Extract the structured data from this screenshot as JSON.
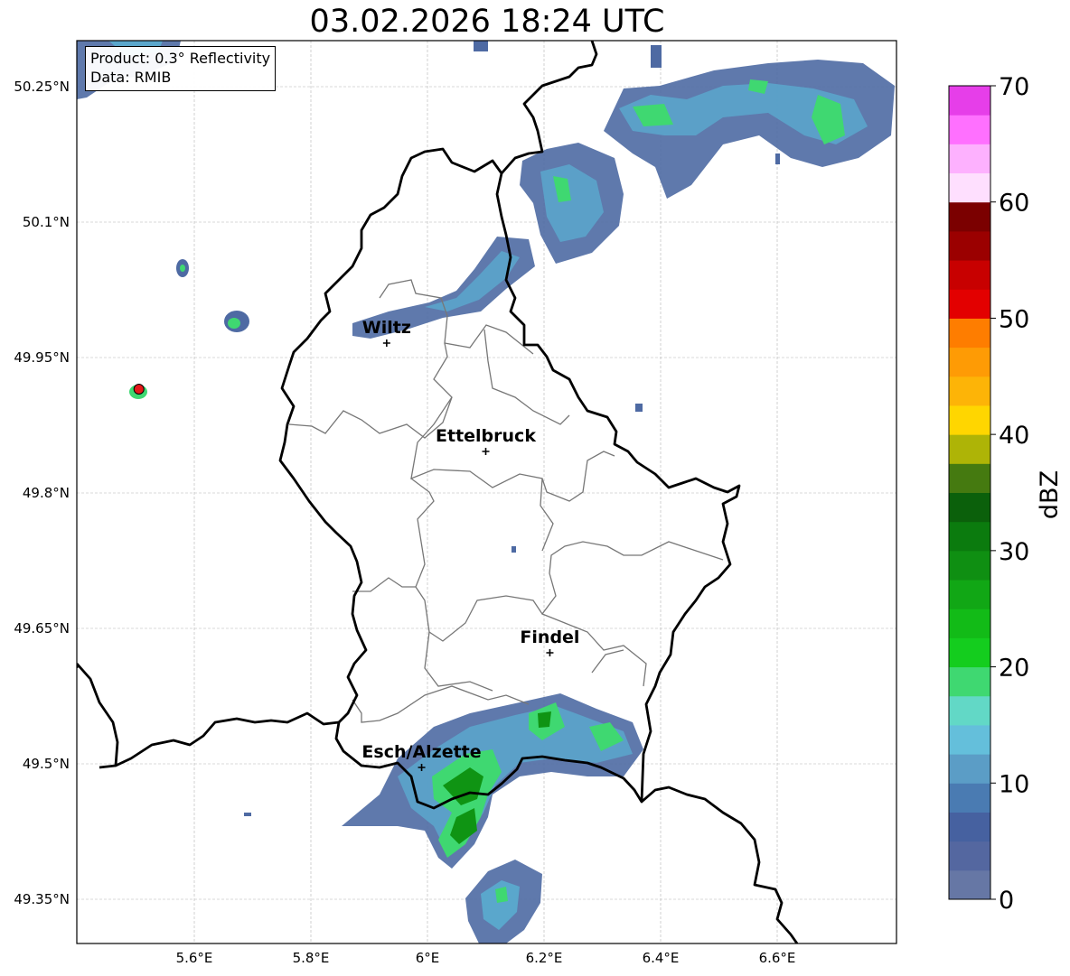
{
  "title": "03.02.2026 18:24 UTC",
  "info": {
    "product": "Product: 0.3° Reflectivity",
    "data": "Data: RMIB"
  },
  "lat_ticks": [
    {
      "value": 50.25,
      "label": "50.25°N"
    },
    {
      "value": 50.1,
      "label": "50.1°N"
    },
    {
      "value": 49.95,
      "label": "49.95°N"
    },
    {
      "value": 49.8,
      "label": "49.8°N"
    },
    {
      "value": 49.65,
      "label": "49.65°N"
    },
    {
      "value": 49.5,
      "label": "49.5°N"
    },
    {
      "value": 49.35,
      "label": "49.35°N"
    }
  ],
  "lon_ticks": [
    {
      "value": 5.6,
      "label": "5.6°E"
    },
    {
      "value": 5.8,
      "label": "5.8°E"
    },
    {
      "value": 6.0,
      "label": "6°E"
    },
    {
      "value": 6.2,
      "label": "6.2°E"
    },
    {
      "value": 6.4,
      "label": "6.4°E"
    },
    {
      "value": 6.6,
      "label": "6.6°E"
    }
  ],
  "cities": [
    {
      "name": "Wiltz",
      "lon": 5.93,
      "lat": 49.966
    },
    {
      "name": "Ettelbruck",
      "lon": 6.1,
      "lat": 49.846
    },
    {
      "name": "Findel",
      "lon": 6.21,
      "lat": 49.623
    },
    {
      "name": "Esch/Alzette",
      "lon": 5.99,
      "lat": 49.496
    }
  ],
  "radar_site": {
    "lon": 5.505,
    "lat": 49.915
  },
  "colorbar": {
    "label": "dBZ",
    "min": 0,
    "max": 70,
    "tick_labels": [
      "0",
      "10",
      "20",
      "30",
      "40",
      "50",
      "60",
      "70"
    ],
    "colors": [
      "#6677a5",
      "#5467a0",
      "#4661a0",
      "#4a7bb2",
      "#5b9dc6",
      "#64bfdb",
      "#62d8c6",
      "#3fd871",
      "#14cd1e",
      "#12bb17",
      "#11a715",
      "#0f8f12",
      "#0b7b0e",
      "#0b600b",
      "#457a10",
      "#aeb406",
      "#ffd600",
      "#fdb407",
      "#fe9b05",
      "#fe7d00",
      "#e30000",
      "#c80000",
      "#9b0000",
      "#7b0000",
      "#fedffe",
      "#fdb1fe",
      "#ff70ff",
      "#e63ee9"
    ]
  }
}
